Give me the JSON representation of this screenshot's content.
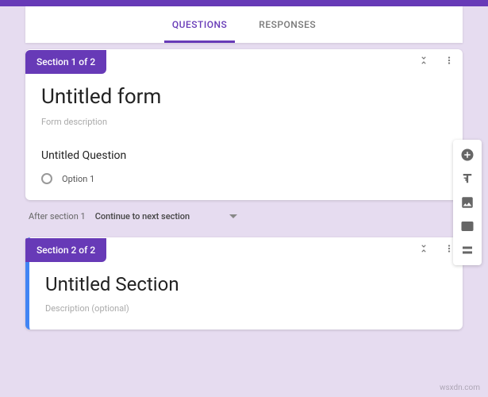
{
  "tabs": {
    "questions": "QUESTIONS",
    "responses": "RESPONSES"
  },
  "colors": {
    "accent": "#673ab7",
    "active_border": "#4285f4"
  },
  "section1": {
    "badge": "Section 1 of 2",
    "title": "Untitled form",
    "description": "Form description",
    "question": "Untitled Question",
    "option1": "Option 1"
  },
  "after_section1": {
    "label": "After section 1",
    "value": "Continue to next section"
  },
  "section2": {
    "badge": "Section 2 of 2",
    "title": "Untitled Section",
    "description": "Description (optional)"
  },
  "watermark": "wsxdn.com"
}
